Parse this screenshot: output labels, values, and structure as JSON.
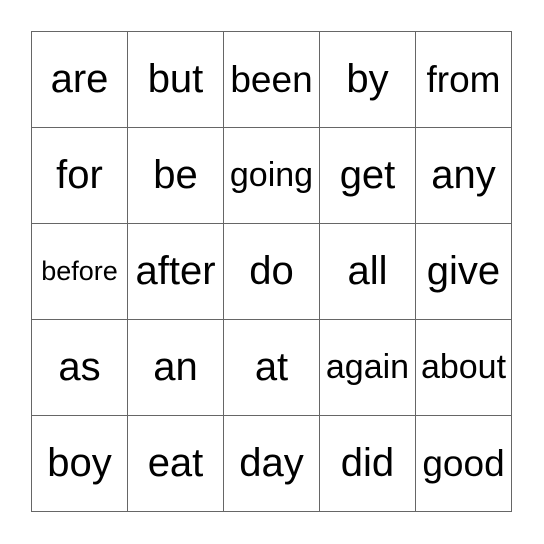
{
  "card": {
    "type": "bingo-card",
    "columns": 5,
    "rows": 5,
    "background_color": "#ffffff",
    "border_color": "#666666",
    "text_color": "#000000",
    "grid": [
      [
        {
          "word": "are",
          "fit": "normal"
        },
        {
          "word": "but",
          "fit": "normal"
        },
        {
          "word": "been",
          "fit": "md"
        },
        {
          "word": "by",
          "fit": "normal"
        },
        {
          "word": "from",
          "fit": "md"
        }
      ],
      [
        {
          "word": "for",
          "fit": "normal"
        },
        {
          "word": "be",
          "fit": "normal"
        },
        {
          "word": "going",
          "fit": "sm"
        },
        {
          "word": "get",
          "fit": "normal"
        },
        {
          "word": "any",
          "fit": "normal"
        }
      ],
      [
        {
          "word": "before",
          "fit": "xs"
        },
        {
          "word": "after",
          "fit": "normal"
        },
        {
          "word": "do",
          "fit": "normal"
        },
        {
          "word": "all",
          "fit": "normal"
        },
        {
          "word": "give",
          "fit": "normal"
        }
      ],
      [
        {
          "word": "as",
          "fit": "normal"
        },
        {
          "word": "an",
          "fit": "normal"
        },
        {
          "word": "at",
          "fit": "normal"
        },
        {
          "word": "again",
          "fit": "sm"
        },
        {
          "word": "about",
          "fit": "sm"
        }
      ],
      [
        {
          "word": "boy",
          "fit": "normal"
        },
        {
          "word": "eat",
          "fit": "normal"
        },
        {
          "word": "day",
          "fit": "normal"
        },
        {
          "word": "did",
          "fit": "normal"
        },
        {
          "word": "good",
          "fit": "md"
        }
      ]
    ]
  }
}
